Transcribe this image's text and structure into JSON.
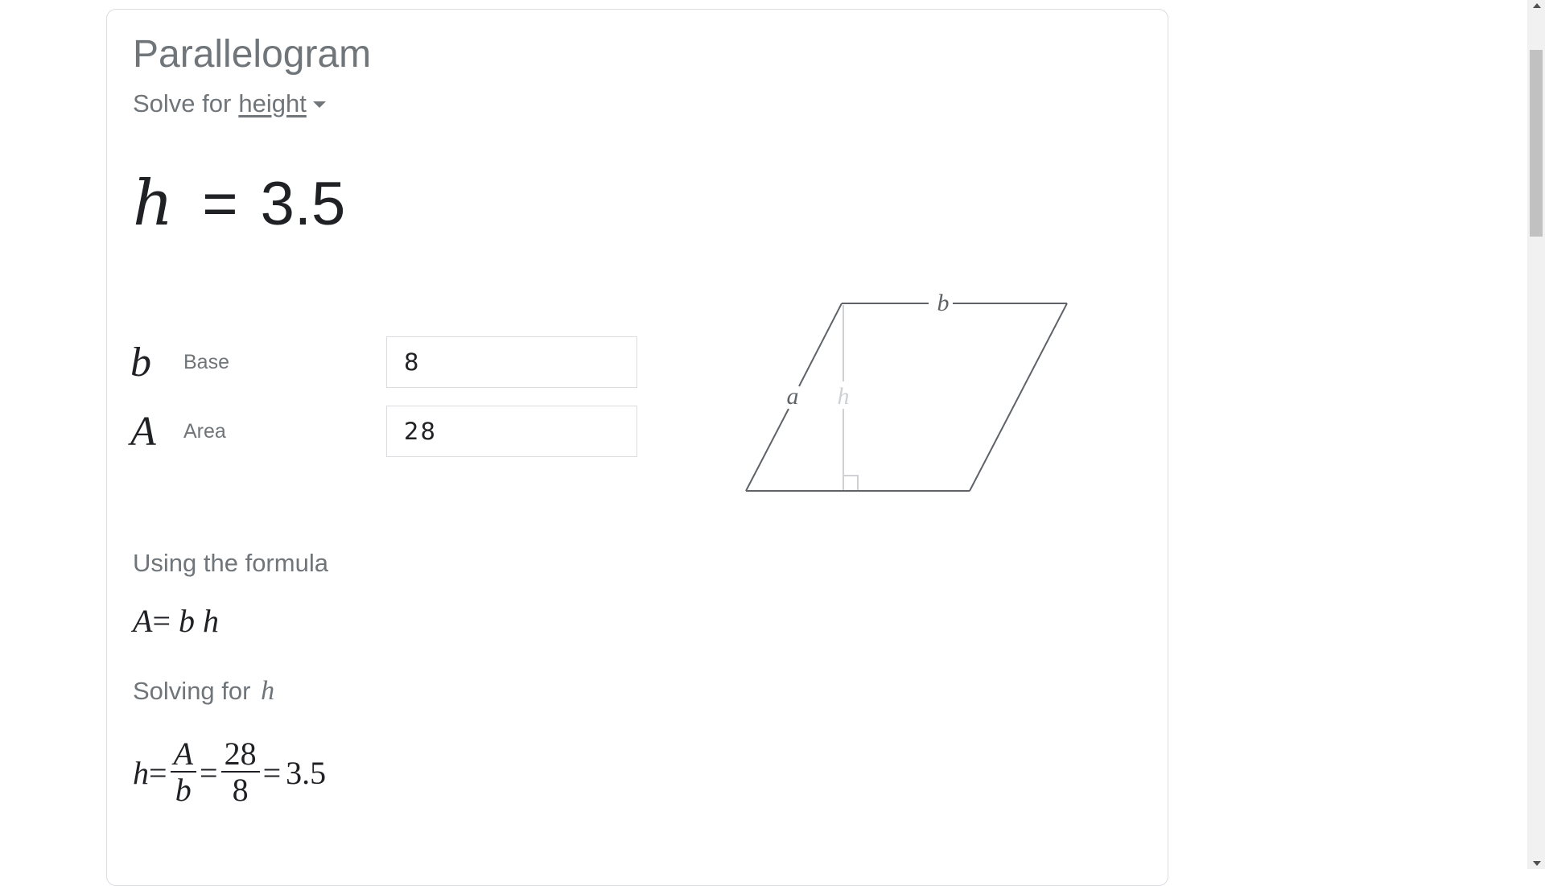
{
  "title": "Parallelogram",
  "solve_for": {
    "prefix": "Solve for",
    "selected": "height"
  },
  "result": {
    "variable": "h",
    "equals": "=",
    "value": "3.5"
  },
  "inputs": [
    {
      "symbol": "b",
      "label": "Base",
      "value": "8"
    },
    {
      "symbol": "A",
      "label": "Area",
      "value": "28"
    }
  ],
  "diagram": {
    "labels": {
      "base": "b",
      "side": "a",
      "height": "h"
    },
    "colors": {
      "outline": "#5f6368",
      "height_line": "#cfd1d4",
      "height_label": "#cfd1d4"
    }
  },
  "formula_section": {
    "heading": "Using the formula",
    "lhs": "A",
    "eq": "=",
    "rhs_b": "b",
    "rhs_h": "h"
  },
  "solving_section": {
    "heading": "Solving for",
    "variable": "h",
    "lhs": "h",
    "eq1": "=",
    "frac1_num": "A",
    "frac1_den": "b",
    "eq2": "=",
    "frac2_num": "28",
    "frac2_den": "8",
    "eq3": "=",
    "result": "3.5"
  },
  "colors": {
    "heading_gray": "#70757a",
    "text_dark": "#202124",
    "border": "#dadce0"
  }
}
